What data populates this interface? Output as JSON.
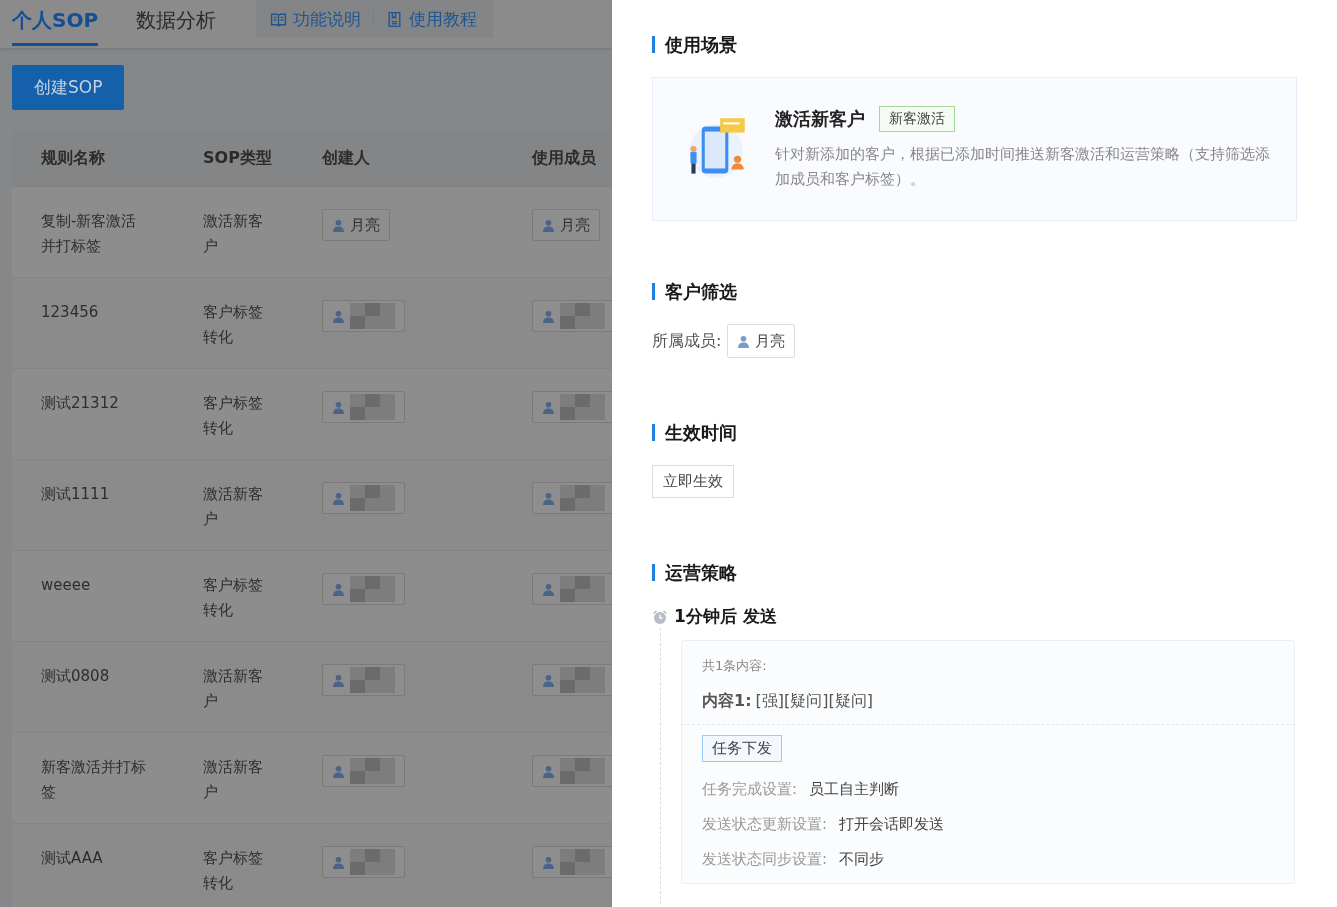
{
  "tabs": [
    {
      "label": "个人SOP",
      "selected": true
    },
    {
      "label": "数据分析",
      "selected": false
    }
  ],
  "help_links": [
    {
      "label": "功能说明",
      "kind": "book"
    },
    {
      "label": "使用教程",
      "kind": "doc"
    }
  ],
  "create_button": "创建SOP",
  "table": {
    "columns": [
      "规则名称",
      "SOP类型",
      "创建人",
      "使用成员"
    ],
    "rows": [
      {
        "name": "复制-新客激活并打标签",
        "type": "激活新客户",
        "creator": {
          "kind": "name",
          "name": "月亮"
        },
        "member": {
          "kind": "name",
          "name": "月亮"
        }
      },
      {
        "name": "123456",
        "type": "客户标签转化",
        "creator": {
          "kind": "redacted"
        },
        "member": {
          "kind": "redacted"
        }
      },
      {
        "name": "测试21312",
        "type": "客户标签转化",
        "creator": {
          "kind": "redacted"
        },
        "member": {
          "kind": "redacted"
        }
      },
      {
        "name": "测试1111",
        "type": "激活新客户",
        "creator": {
          "kind": "redacted"
        },
        "member": {
          "kind": "redacted"
        }
      },
      {
        "name": "weeee",
        "type": "客户标签转化",
        "creator": {
          "kind": "redacted"
        },
        "member": {
          "kind": "redacted"
        }
      },
      {
        "name": "测试0808",
        "type": "激活新客户",
        "creator": {
          "kind": "redacted"
        },
        "member": {
          "kind": "redacted"
        }
      },
      {
        "name": "新客激活并打标签",
        "type": "激活新客户",
        "creator": {
          "kind": "redacted"
        },
        "member": {
          "kind": "redacted"
        }
      },
      {
        "name": "测试AAA",
        "type": "客户标签转化",
        "creator": {
          "kind": "redacted"
        },
        "member": {
          "kind": "redacted"
        }
      }
    ]
  },
  "drawer": {
    "scene": {
      "heading": "使用场景",
      "title": "激活新客户",
      "tag": "新客激活",
      "description": "针对新添加的客户，根据已添加时间推送新客激活和运营策略（支持筛选添加成员和客户标签）。"
    },
    "filter": {
      "heading": "客户筛选",
      "label": "所属成员:",
      "member": "月亮"
    },
    "effective": {
      "heading": "生效时间",
      "value": "立即生效"
    },
    "strategy": {
      "heading": "运营策略",
      "step": {
        "time": "1分钟后 发送",
        "count_label": "共1条内容:",
        "content_label": "内容1:",
        "content": "[强][疑问][疑问]",
        "task_tag": "任务下发",
        "settings": [
          {
            "label": "任务完成设置:",
            "value": "员工自主判断"
          },
          {
            "label": "发送状态更新设置:",
            "value": "打开会话即发送"
          },
          {
            "label": "发送状态同步设置:",
            "value": "不同步"
          }
        ]
      }
    }
  }
}
